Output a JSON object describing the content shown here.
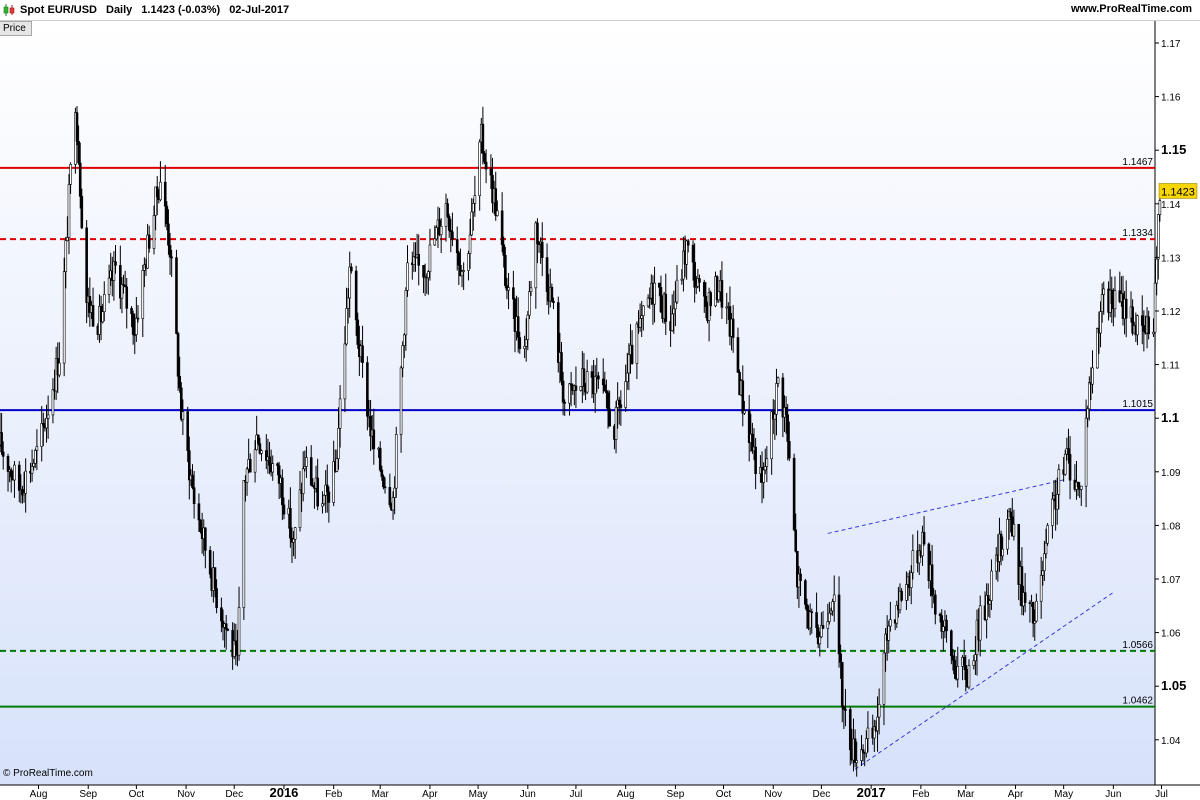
{
  "header": {
    "instrument": "Spot EUR/USD",
    "period": "Daily",
    "last": "1.1423 (-0.03%)",
    "date": "02-Jul-2017",
    "source": "www.ProRealTime.com"
  },
  "panel_tab": "Price",
  "footer": {
    "copyright": "© ProRealTime.com"
  },
  "colors": {
    "background_top": "#ffffff",
    "background_bottom": "#d7e2fa",
    "candle": "#000000",
    "resistance": "#e00000",
    "support_blue": "#0000c8",
    "support_green": "#007a00",
    "trend": "#3a3ad8",
    "last_price_box": "#f7d500"
  },
  "chart_data": {
    "type": "line",
    "subtype": "candlestick-daily",
    "title": "Spot EUR/USD",
    "xlabel": "",
    "ylabel": "",
    "ylim": [
      1.03,
      1.175
    ],
    "grid": false,
    "y_ticks": [
      "1.17",
      "1.16",
      "1.15",
      "1.14",
      "1.13",
      "1.12",
      "1.11",
      "1.1",
      "1.09",
      "1.08",
      "1.07",
      "1.06",
      "1.05",
      "1.04"
    ],
    "y_ticks_bold": [
      "1.15",
      "1.1",
      "1.05"
    ],
    "x_ticks": [
      {
        "label": "Aug",
        "date": "2015-08-01"
      },
      {
        "label": "Sep",
        "date": "2015-09-01"
      },
      {
        "label": "Oct",
        "date": "2015-10-01"
      },
      {
        "label": "Nov",
        "date": "2015-11-01"
      },
      {
        "label": "Dec",
        "date": "2015-12-01"
      },
      {
        "label": "2016",
        "date": "2016-01-01",
        "bold": true
      },
      {
        "label": "Feb",
        "date": "2016-02-01"
      },
      {
        "label": "Mar",
        "date": "2016-03-01"
      },
      {
        "label": "Apr",
        "date": "2016-04-01"
      },
      {
        "label": "May",
        "date": "2016-05-01"
      },
      {
        "label": "Jun",
        "date": "2016-06-01"
      },
      {
        "label": "Jul",
        "date": "2016-07-01"
      },
      {
        "label": "Aug",
        "date": "2016-08-01"
      },
      {
        "label": "Sep",
        "date": "2016-09-01"
      },
      {
        "label": "Oct",
        "date": "2016-10-01"
      },
      {
        "label": "Nov",
        "date": "2016-11-01"
      },
      {
        "label": "Dec",
        "date": "2016-12-01"
      },
      {
        "label": "2017",
        "date": "2017-01-01",
        "bold": true
      },
      {
        "label": "Feb",
        "date": "2017-02-01"
      },
      {
        "label": "Mar",
        "date": "2017-03-01"
      },
      {
        "label": "Apr",
        "date": "2017-04-01"
      },
      {
        "label": "May",
        "date": "2017-05-01"
      },
      {
        "label": "Jun",
        "date": "2017-06-01"
      },
      {
        "label": "Jul",
        "date": "2017-07-01"
      }
    ],
    "x_range": [
      "2015-07-08",
      "2017-07-25"
    ],
    "series": [
      {
        "points": [
          [
            "2015-07-08",
            1.095
          ],
          [
            "2015-07-20",
            1.087
          ],
          [
            "2015-08-01",
            1.094
          ],
          [
            "2015-08-14",
            1.112
          ],
          [
            "2015-08-24",
            1.16
          ],
          [
            "2015-08-31",
            1.122
          ],
          [
            "2015-09-08",
            1.118
          ],
          [
            "2015-09-18",
            1.128
          ],
          [
            "2015-09-30",
            1.117
          ],
          [
            "2015-10-09",
            1.134
          ],
          [
            "2015-10-16",
            1.145
          ],
          [
            "2015-10-22",
            1.132
          ],
          [
            "2015-10-29",
            1.101
          ],
          [
            "2015-11-06",
            1.085
          ],
          [
            "2015-11-20",
            1.067
          ],
          [
            "2015-12-03",
            1.054
          ],
          [
            "2015-12-07",
            1.088
          ],
          [
            "2015-12-15",
            1.097
          ],
          [
            "2015-12-22",
            1.093
          ],
          [
            "2015-12-30",
            1.088
          ],
          [
            "2016-01-07",
            1.076
          ],
          [
            "2016-01-14",
            1.092
          ],
          [
            "2016-01-25",
            1.083
          ],
          [
            "2016-02-02",
            1.09
          ],
          [
            "2016-02-11",
            1.128
          ],
          [
            "2016-02-16",
            1.115
          ],
          [
            "2016-02-26",
            1.094
          ],
          [
            "2016-03-09",
            1.085
          ],
          [
            "2016-03-18",
            1.128
          ],
          [
            "2016-03-29",
            1.128
          ],
          [
            "2016-04-11",
            1.14
          ],
          [
            "2016-04-22",
            1.127
          ],
          [
            "2016-04-29",
            1.141
          ],
          [
            "2016-05-03",
            1.152
          ],
          [
            "2016-05-12",
            1.14
          ],
          [
            "2016-05-20",
            1.122
          ],
          [
            "2016-05-30",
            1.113
          ],
          [
            "2016-06-06",
            1.136
          ],
          [
            "2016-06-16",
            1.122
          ],
          [
            "2016-06-24",
            1.103
          ],
          [
            "2016-07-05",
            1.107
          ],
          [
            "2016-07-15",
            1.106
          ],
          [
            "2016-07-25",
            1.098
          ],
          [
            "2016-08-05",
            1.112
          ],
          [
            "2016-08-19",
            1.125
          ],
          [
            "2016-08-29",
            1.118
          ],
          [
            "2016-09-08",
            1.132
          ],
          [
            "2016-09-19",
            1.12
          ],
          [
            "2016-09-28",
            1.125
          ],
          [
            "2016-10-07",
            1.115
          ],
          [
            "2016-10-13",
            1.103
          ],
          [
            "2016-10-25",
            1.087
          ],
          [
            "2016-11-04",
            1.107
          ],
          [
            "2016-11-09",
            1.1
          ],
          [
            "2016-11-16",
            1.07
          ],
          [
            "2016-11-28",
            1.058
          ],
          [
            "2016-12-08",
            1.068
          ],
          [
            "2016-12-15",
            1.045
          ],
          [
            "2016-12-21",
            1.038
          ],
          [
            "2017-01-03",
            1.04
          ],
          [
            "2017-01-12",
            1.062
          ],
          [
            "2017-01-24",
            1.07
          ],
          [
            "2017-02-02",
            1.078
          ],
          [
            "2017-02-10",
            1.066
          ],
          [
            "2017-02-22",
            1.054
          ],
          [
            "2017-03-02",
            1.052
          ],
          [
            "2017-03-09",
            1.061
          ],
          [
            "2017-03-20",
            1.073
          ],
          [
            "2017-03-28",
            1.083
          ],
          [
            "2017-04-06",
            1.066
          ],
          [
            "2017-04-13",
            1.062
          ],
          [
            "2017-04-24",
            1.083
          ],
          [
            "2017-05-03",
            1.093
          ],
          [
            "2017-05-11",
            1.086
          ],
          [
            "2017-05-16",
            1.103
          ],
          [
            "2017-05-24",
            1.121
          ],
          [
            "2017-05-31",
            1.122
          ],
          [
            "2017-06-09",
            1.121
          ],
          [
            "2017-06-19",
            1.115
          ],
          [
            "2017-06-26",
            1.119
          ],
          [
            "2017-06-30",
            1.142
          ],
          [
            "2017-07-02",
            1.1423
          ]
        ]
      }
    ],
    "horizontal_levels": [
      {
        "value": 1.1467,
        "label": "1.1467",
        "color": "#e00000",
        "style": "solid"
      },
      {
        "value": 1.1334,
        "label": "1.1334",
        "color": "#e00000",
        "style": "dashed"
      },
      {
        "value": 1.1015,
        "label": "1.1015",
        "color": "#0000c8",
        "style": "solid"
      },
      {
        "value": 1.0566,
        "label": "1.0566",
        "color": "#007a00",
        "style": "dashed"
      },
      {
        "value": 1.0462,
        "label": "1.0462",
        "color": "#007a00",
        "style": "solid"
      }
    ],
    "trendlines": [
      {
        "from": [
          "2016-12-05",
          1.0785
        ],
        "to": [
          "2017-05-01",
          1.0885
        ],
        "style": "dashed"
      },
      {
        "from": [
          "2016-12-22",
          1.0345
        ],
        "to": [
          "2017-06-01",
          1.0675
        ],
        "style": "dashed"
      }
    ],
    "last_price": {
      "value": 1.1423,
      "label": "1.1423"
    }
  }
}
